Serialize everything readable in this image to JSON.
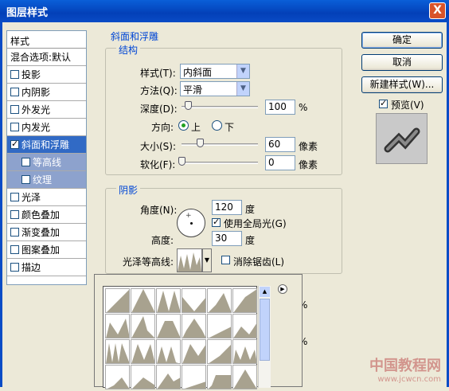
{
  "window": {
    "title": "图层样式",
    "close": "X"
  },
  "style_list": {
    "header": "样式",
    "blend": "混合选项:默认",
    "items": [
      {
        "label": "投影",
        "checked": false
      },
      {
        "label": "内阴影",
        "checked": false
      },
      {
        "label": "外发光",
        "checked": false
      },
      {
        "label": "内发光",
        "checked": false
      },
      {
        "label": "斜面和浮雕",
        "checked": true,
        "selected": true
      },
      {
        "label": "等高线",
        "checked": false,
        "sub": true
      },
      {
        "label": "纹理",
        "checked": false,
        "sub": true
      },
      {
        "label": "光泽",
        "checked": false
      },
      {
        "label": "颜色叠加",
        "checked": false
      },
      {
        "label": "渐变叠加",
        "checked": false
      },
      {
        "label": "图案叠加",
        "checked": false
      },
      {
        "label": "描边",
        "checked": false
      }
    ]
  },
  "bevel": {
    "title": "斜面和浮雕",
    "structure": {
      "title": "结构",
      "style_label": "样式(T):",
      "style_value": "内斜面",
      "method_label": "方法(Q):",
      "method_value": "平滑",
      "depth_label": "深度(D):",
      "depth_value": "100",
      "depth_unit": "%",
      "depth_level": 0.08,
      "direction_label": "方向:",
      "dir_up": "上",
      "dir_down": "下",
      "size_label": "大小(S):",
      "size_value": "60",
      "size_unit": "像素",
      "size_level": 0.24,
      "soften_label": "软化(F):",
      "soften_value": "0",
      "soften_unit": "像素",
      "soften_level": 0.0
    },
    "shading": {
      "title": "阴影",
      "angle_label": "角度(N):",
      "angle_value": "120",
      "angle_unit": "度",
      "global_light": "使用全局光(G)",
      "altitude_label": "高度:",
      "altitude_value": "30",
      "altitude_unit": "度",
      "gloss_label": "光泽等高线:",
      "antialias": "消除锯齿(L)",
      "pct1": "%",
      "pct2": "%"
    }
  },
  "buttons": {
    "ok": "确定",
    "cancel": "取消",
    "new_style": "新建样式(W)...",
    "preview": "预览(V)"
  },
  "watermark": {
    "line1": "中国教程网",
    "line2": "www.jcwcn.com"
  }
}
